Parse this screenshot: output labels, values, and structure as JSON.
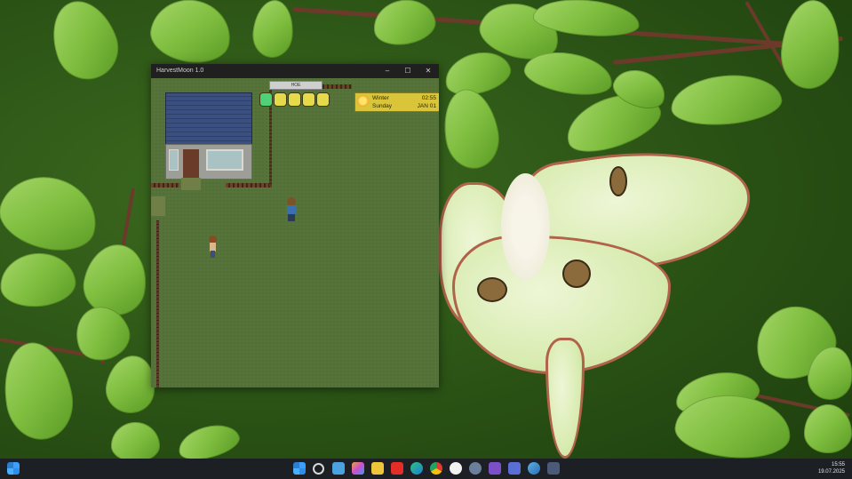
{
  "window": {
    "title": "HarvestMoon 1.0",
    "minimize_glyph": "–",
    "maximize_glyph": "☐",
    "close_glyph": "✕"
  },
  "hud": {
    "season": "Winter",
    "time": "02:55",
    "day": "Sunday",
    "date": "JAN 01",
    "badge": "HOE",
    "icon": "sun-icon",
    "stamina_cells": 5,
    "stamina_colors": [
      "#4fd17a",
      "#e6d94a",
      "#e6d94a",
      "#e6d94a",
      "#e6d94a"
    ]
  },
  "taskbar": {
    "time": "15:55",
    "date": "19.07.2025",
    "icons": [
      "windows-start-icon",
      "search-icon",
      "notepad-icon",
      "copilot-icon",
      "file-explorer-icon",
      "youtube-icon",
      "edge-icon",
      "chrome-icon",
      "yandex-icon",
      "app-icon",
      "visual-studio-icon",
      "save-icon",
      "edge-dev-icon",
      "terminal-icon"
    ]
  },
  "colors": {
    "titlebar": "#202020",
    "grass": "#56733a",
    "hud": "#d9c43a",
    "taskbar": "#1c1f24"
  }
}
